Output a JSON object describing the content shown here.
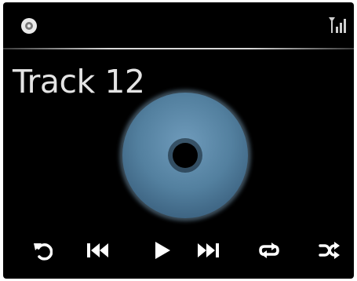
{
  "status_bar": {
    "source_icon": "cd-icon",
    "signal_icon": "signal-antenna-icon"
  },
  "track": {
    "title": "Track 12"
  },
  "album_art": {
    "icon": "cd-disc-icon",
    "color": "#5a86a6"
  },
  "controls": [
    {
      "id": "back",
      "icon": "back-icon"
    },
    {
      "id": "previous",
      "icon": "skip-previous-icon"
    },
    {
      "id": "play",
      "icon": "play-icon"
    },
    {
      "id": "next",
      "icon": "skip-next-icon"
    },
    {
      "id": "repeat",
      "icon": "repeat-icon"
    },
    {
      "id": "shuffle",
      "icon": "shuffle-icon"
    }
  ],
  "colors": {
    "background": "#000000",
    "text": "#e4e4e4",
    "icon": "#ffffff",
    "disc": "#5a86a6"
  }
}
